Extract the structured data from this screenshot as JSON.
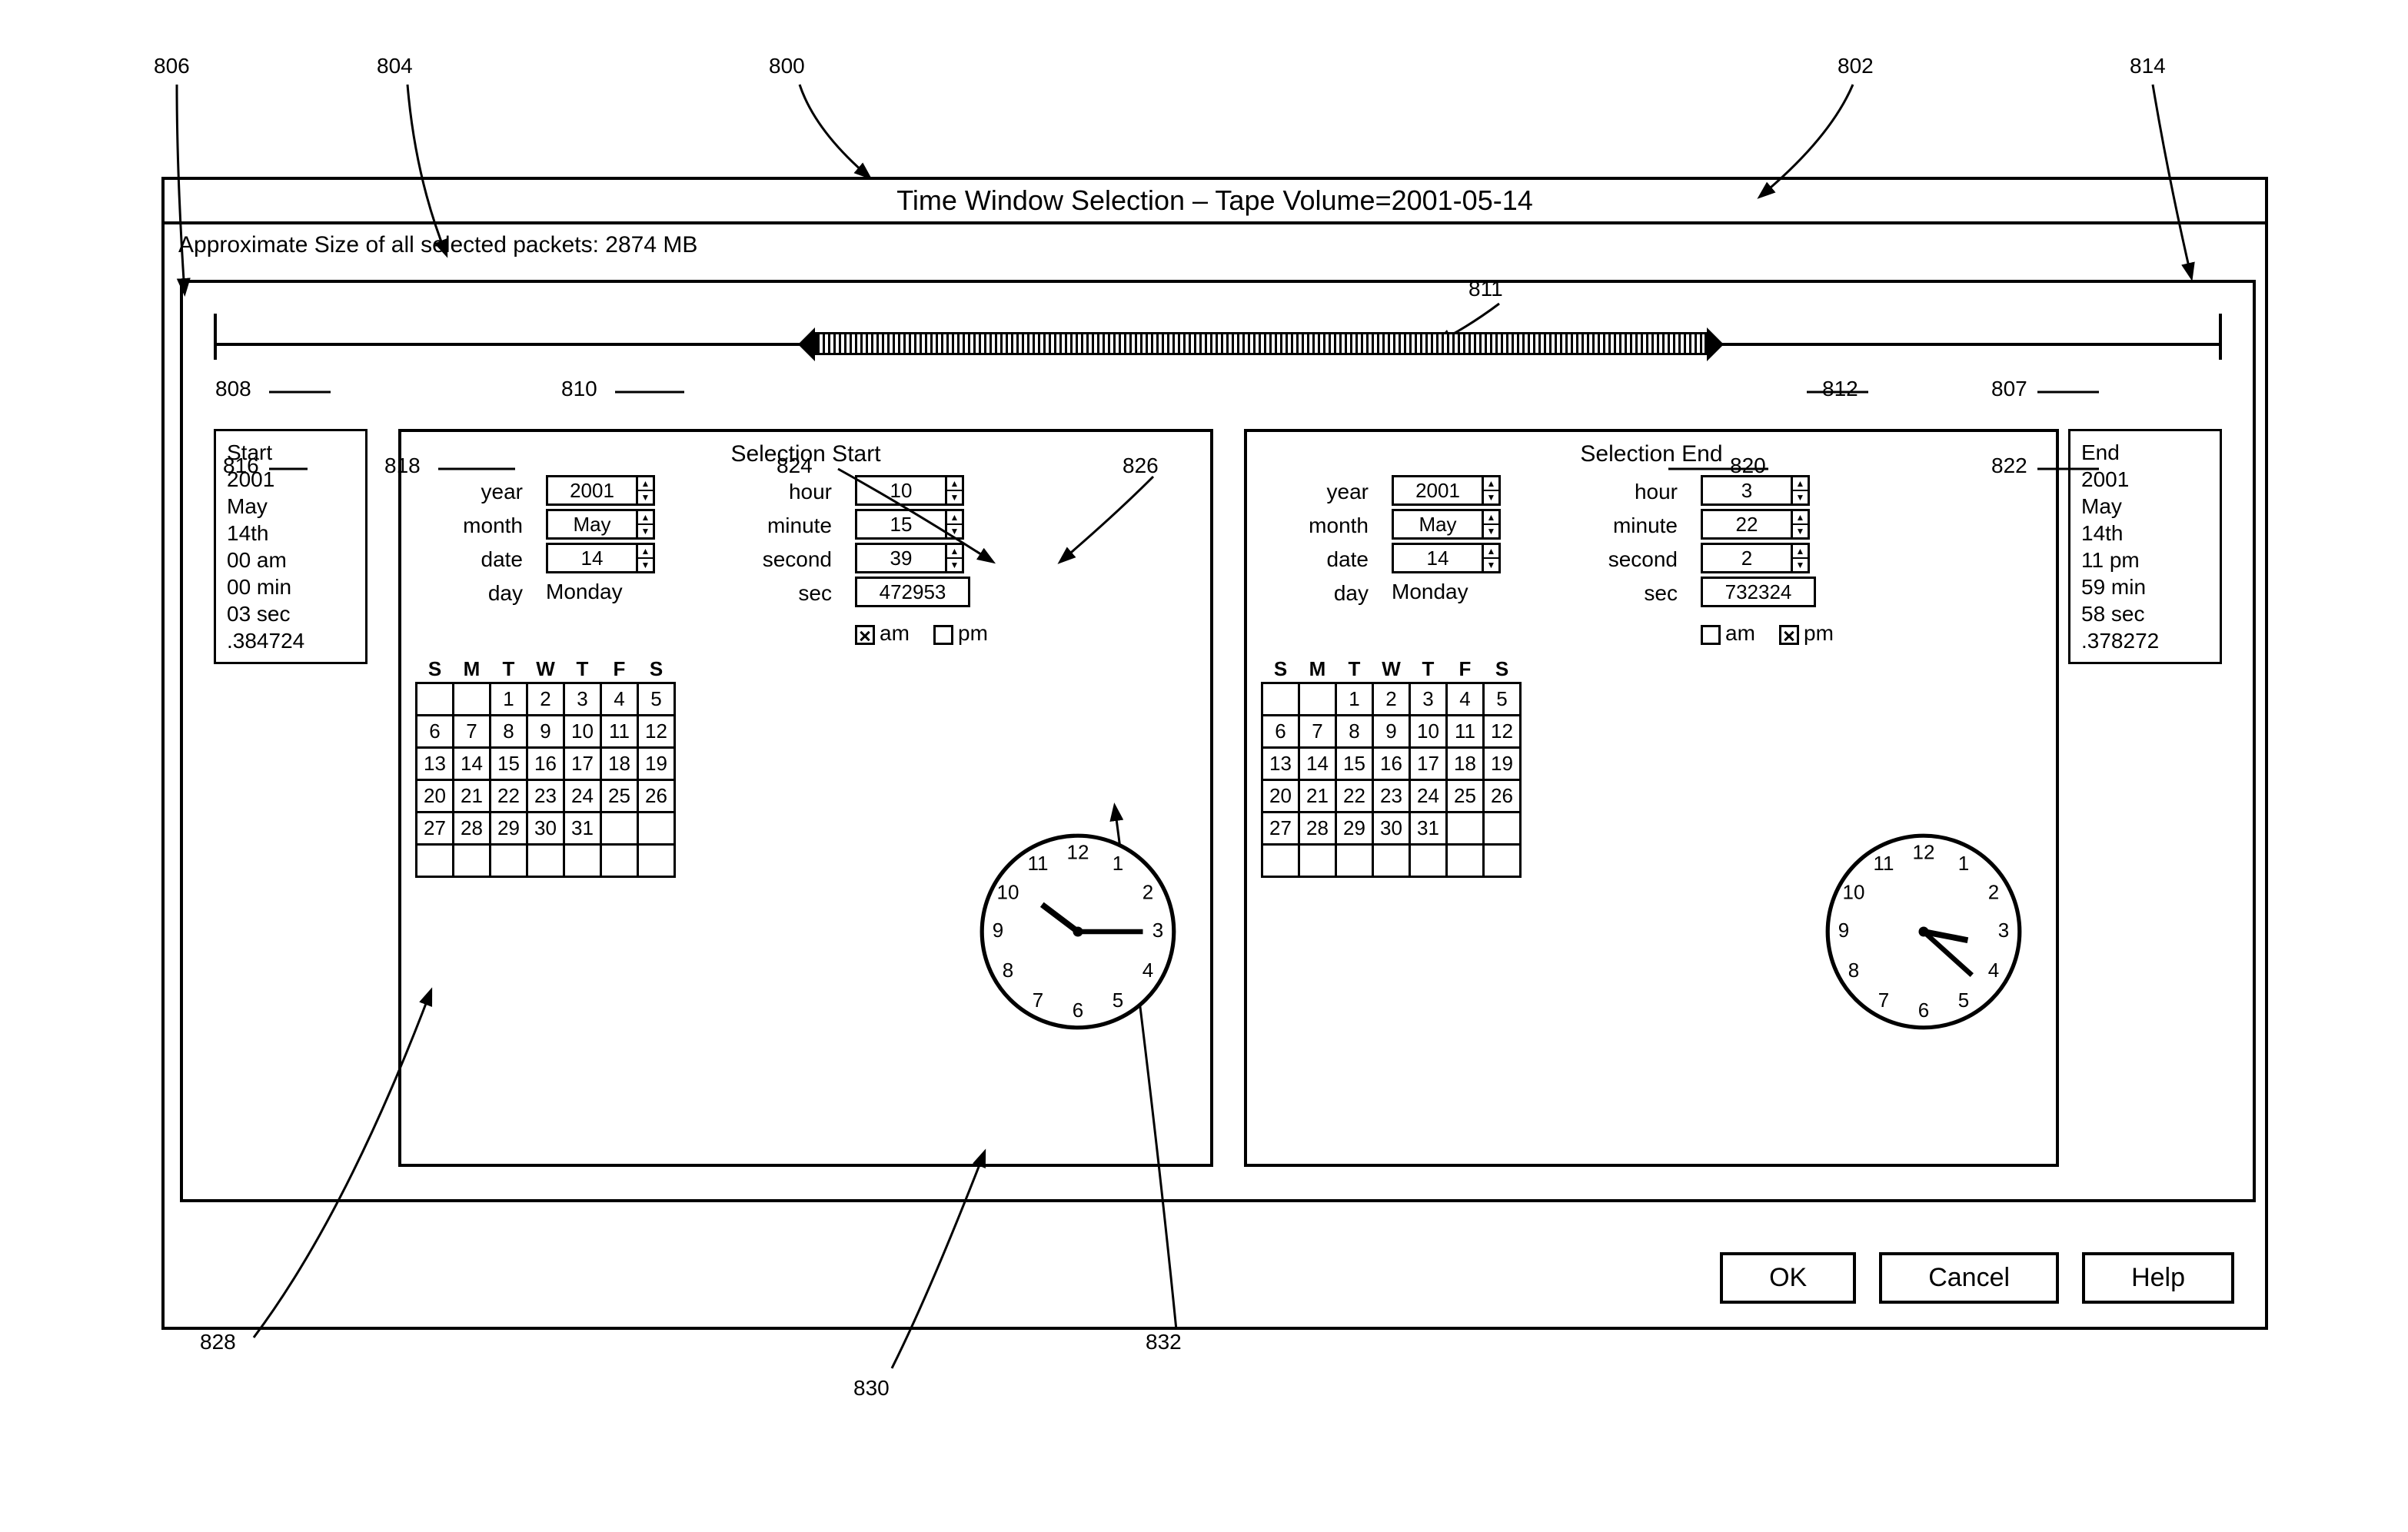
{
  "refs": {
    "r800": "800",
    "r802": "802",
    "r804": "804",
    "r806": "806",
    "r807": "807",
    "r808": "808",
    "r810": "810",
    "r811": "811",
    "r812": "812",
    "r814": "814",
    "r816": "816",
    "r818": "818",
    "r820": "820",
    "r822": "822",
    "r824": "824",
    "r826": "826",
    "r828": "828",
    "r830": "830",
    "r832": "832"
  },
  "title": "Time Window Selection – Tape Volume=2001-05-14",
  "approxSize": "Approximate Size of all selected packets: 2874 MB",
  "startInfo": [
    "Start",
    "2001",
    "May",
    "14th",
    "00 am",
    "00 min",
    "03 sec",
    ".384724"
  ],
  "endInfo": [
    "End",
    "2001",
    "May",
    "14th",
    "11 pm",
    "59 min",
    "58 sec",
    ".378272"
  ],
  "labels": {
    "selStart": "Selection Start",
    "selEnd": "Selection End",
    "year": "year",
    "month": "month",
    "date": "date",
    "day": "day",
    "hour": "hour",
    "minute": "minute",
    "second": "second",
    "sec": "sec",
    "am": "am",
    "pm": "pm",
    "dow": [
      "S",
      "M",
      "T",
      "W",
      "T",
      "F",
      "S"
    ]
  },
  "start": {
    "year": "2001",
    "month": "May",
    "date": "14",
    "day": "Monday",
    "hour": "10",
    "minute": "15",
    "second": "39",
    "usec": "472953",
    "am": true,
    "pm": false
  },
  "end": {
    "year": "2001",
    "month": "May",
    "date": "14",
    "day": "Monday",
    "hour": "3",
    "minute": "22",
    "second": "2",
    "usec": "732324",
    "am": false,
    "pm": true
  },
  "calendar": [
    [
      "",
      "",
      "1",
      "2",
      "3",
      "4",
      "5"
    ],
    [
      "6",
      "7",
      "8",
      "9",
      "10",
      "11",
      "12"
    ],
    [
      "13",
      "14",
      "15",
      "16",
      "17",
      "18",
      "19"
    ],
    [
      "20",
      "21",
      "22",
      "23",
      "24",
      "25",
      "26"
    ],
    [
      "27",
      "28",
      "29",
      "30",
      "31",
      "",
      ""
    ],
    [
      "",
      "",
      "",
      "",
      "",
      "",
      ""
    ]
  ],
  "buttons": {
    "ok": "OK",
    "cancel": "Cancel",
    "help": "Help"
  },
  "clock": {
    "start": {
      "hourAngle": 307,
      "minAngle": 90
    },
    "end": {
      "hourAngle": 101,
      "minAngle": 132
    }
  }
}
